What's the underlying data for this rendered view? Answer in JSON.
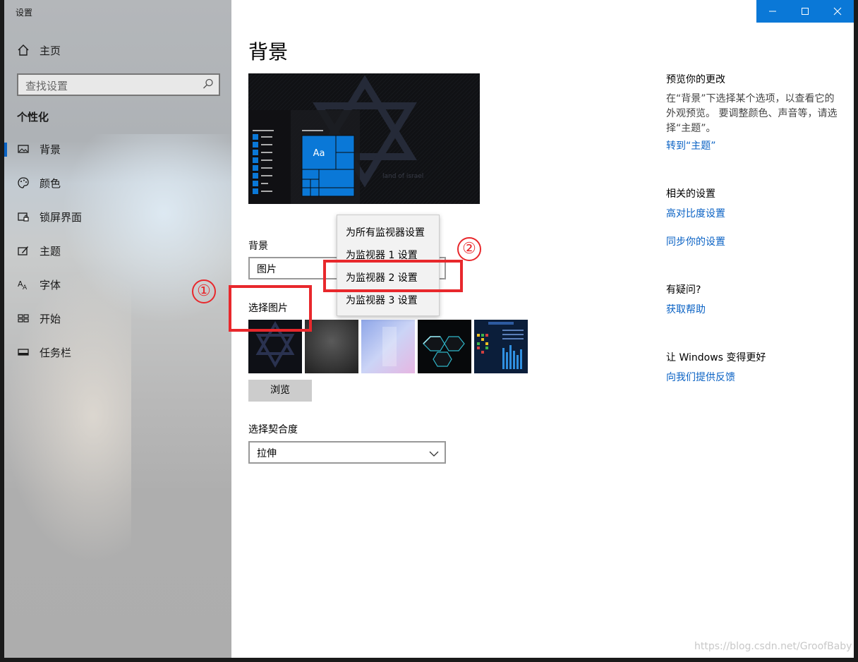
{
  "window": {
    "title": "设置",
    "controls": {
      "minimize": "—",
      "maximize": "☐",
      "close": "✕"
    }
  },
  "sidebar": {
    "home": "主页",
    "search_placeholder": "查找设置",
    "section": "个性化",
    "items": [
      {
        "label": "背景",
        "icon": "image-icon",
        "active": true
      },
      {
        "label": "颜色",
        "icon": "palette-icon"
      },
      {
        "label": "锁屏界面",
        "icon": "lock-screen-icon"
      },
      {
        "label": "主题",
        "icon": "theme-icon"
      },
      {
        "label": "字体",
        "icon": "font-icon"
      },
      {
        "label": "开始",
        "icon": "start-icon"
      },
      {
        "label": "任务栏",
        "icon": "taskbar-icon"
      }
    ]
  },
  "main": {
    "title": "背景",
    "preview": {
      "tile_text": "Aa",
      "wallpaper_text": "land of israel"
    },
    "background_label": "背景",
    "background_value": "图片",
    "choose_picture_label": "选择图片",
    "browse_button": "浏览",
    "fit_label": "选择契合度",
    "fit_value": "拉伸"
  },
  "context_menu": {
    "items": [
      "为所有监视器设置",
      "为监视器 1 设置",
      "为监视器 2 设置",
      "为监视器 3 设置"
    ],
    "highlighted_index": 2
  },
  "annotations": {
    "marker1": "①",
    "marker2": "②",
    "color": "#e8282c"
  },
  "right_panel": {
    "preview_heading": "预览你的更改",
    "preview_text": "在“背景”下选择某个选项，以查看它的外观预览。 要调整颜色、声音等，请选择“主题”。",
    "preview_link": "转到“主题”",
    "related_heading": "相关的设置",
    "related_links": [
      "高对比度设置",
      "同步你的设置"
    ],
    "help_heading": "有疑问?",
    "help_link": "获取帮助",
    "improve_heading": "让 Windows 变得更好",
    "improve_link": "向我们提供反馈"
  },
  "watermark": "https://blog.csdn.net/GroofBaby",
  "colors": {
    "accent": "#0a78d7",
    "link": "#0a62c4",
    "annotation": "#e8282c"
  }
}
